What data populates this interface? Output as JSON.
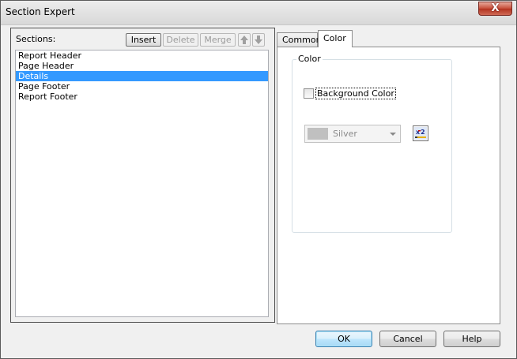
{
  "window": {
    "title": "Section Expert",
    "close_glyph": "X"
  },
  "left_panel": {
    "sections_label": "Sections:",
    "buttons": {
      "insert": "Insert",
      "delete": "Delete",
      "merge": "Merge"
    },
    "sections": [
      "Report Header",
      "Page Header",
      "Details",
      "Page Footer",
      "Report Footer"
    ],
    "selected_index": 2
  },
  "tabs": [
    {
      "label": "Common",
      "active": false
    },
    {
      "label": "Color",
      "active": true
    }
  ],
  "color_tab": {
    "group_label": "Color",
    "background_color_label": "Background Color",
    "background_color_checked": false,
    "color_value": "Silver",
    "color_value_hex": "#C0C0C0",
    "formula_icon": "formula-x2-icon"
  },
  "dialog_buttons": {
    "ok": "OK",
    "cancel": "Cancel",
    "help": "Help"
  },
  "colors": {
    "selection": "#3399ff",
    "close_button": "#c54b36"
  }
}
